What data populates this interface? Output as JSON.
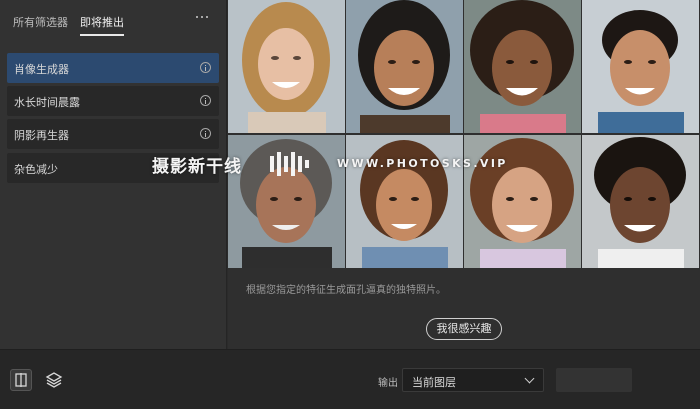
{
  "sidebar": {
    "tabs": [
      "所有筛选器",
      "即将推出"
    ],
    "active_tab": "即将推出",
    "more_icon": "more-horizontal-icon",
    "items": [
      {
        "label": "肖像生成器",
        "active": true,
        "icon": "info-icon"
      },
      {
        "label": "水长时间晨露",
        "active": false,
        "icon": "info-icon"
      },
      {
        "label": "阴影再生器",
        "active": false,
        "icon": "info-icon"
      },
      {
        "label": "杂色减少",
        "active": false
      }
    ]
  },
  "preview": {
    "description": "根据您指定的特征生成面孔逼真的独特照片。",
    "cta_label": "我很感兴趣"
  },
  "watermark": {
    "cn": "摄影新干线",
    "en": "WWW.PHOTOSKS.VIP"
  },
  "footer": {
    "compare_icon": "compare-split-icon",
    "layers_icon": "layers-stack-icon",
    "output_label": "输出",
    "output_value": "当前图层"
  },
  "colors": {
    "accent": "#2c4a70",
    "panel": "#323232",
    "footer": "#262626"
  }
}
